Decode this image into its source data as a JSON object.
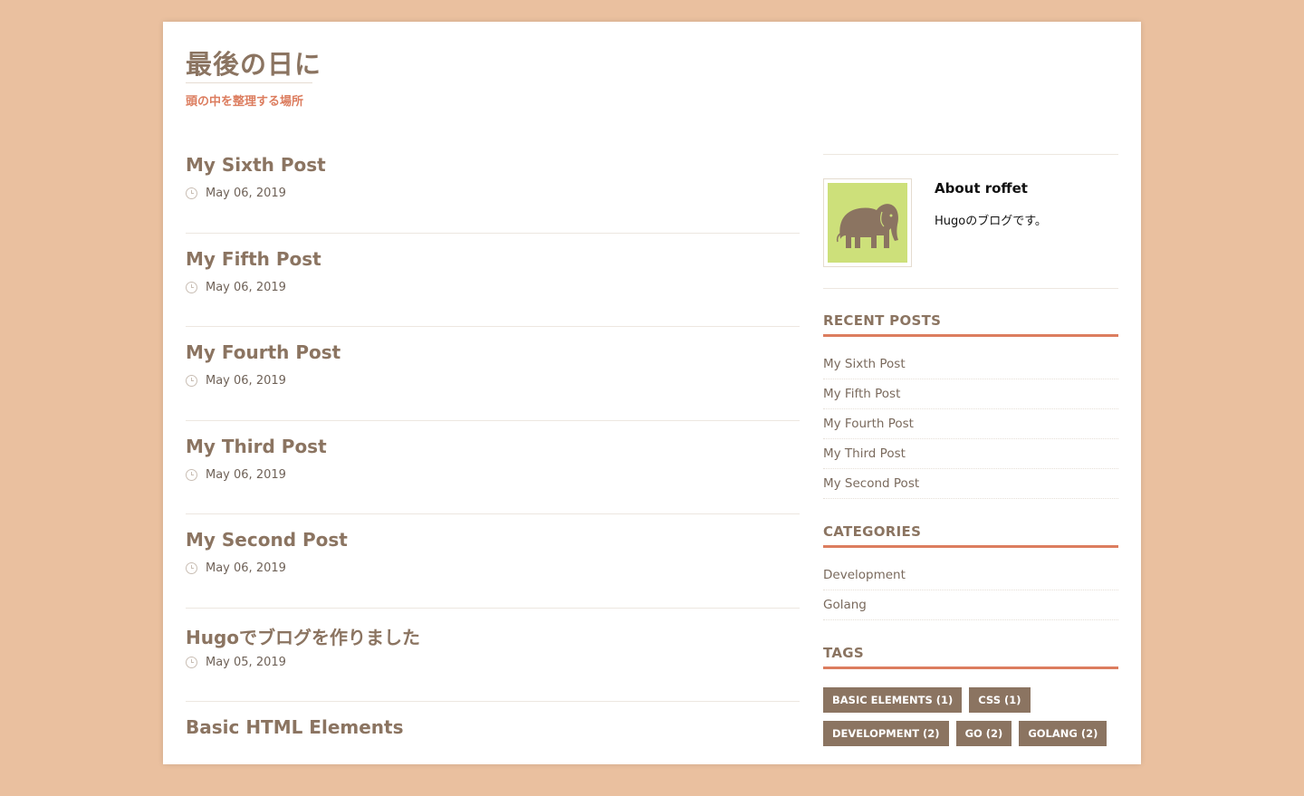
{
  "site": {
    "title": "最後の日に",
    "description": "頭の中を整理する場所"
  },
  "posts": [
    {
      "title": "My Sixth Post",
      "date": "May 06, 2019"
    },
    {
      "title": "My Fifth Post",
      "date": "May 06, 2019"
    },
    {
      "title": "My Fourth Post",
      "date": "May 06, 2019"
    },
    {
      "title": "My Third Post",
      "date": "May 06, 2019"
    },
    {
      "title": "My Second Post",
      "date": "May 06, 2019"
    },
    {
      "title": "Hugoでブログを作りました",
      "date": "May 05, 2019"
    },
    {
      "title": "Basic HTML Elements",
      "date": ""
    }
  ],
  "about": {
    "title": "About roffet",
    "text": "Hugoのブログです。"
  },
  "recent_posts": {
    "title": "RECENT POSTS",
    "items": [
      "My Sixth Post",
      "My Fifth Post",
      "My Fourth Post",
      "My Third Post",
      "My Second Post"
    ]
  },
  "categories": {
    "title": "CATEGORIES",
    "items": [
      "Development",
      "Golang"
    ]
  },
  "tags": {
    "title": "TAGS",
    "items": [
      "BASIC ELEMENTS (1)",
      "CSS (1)",
      "DEVELOPMENT (2)",
      "GO (2)",
      "GOLANG (2)"
    ]
  },
  "colors": {
    "background": "#eac09f",
    "accent": "#dc7d5f",
    "brown": "#8b7461",
    "avatar_bg": "#cde07a"
  }
}
